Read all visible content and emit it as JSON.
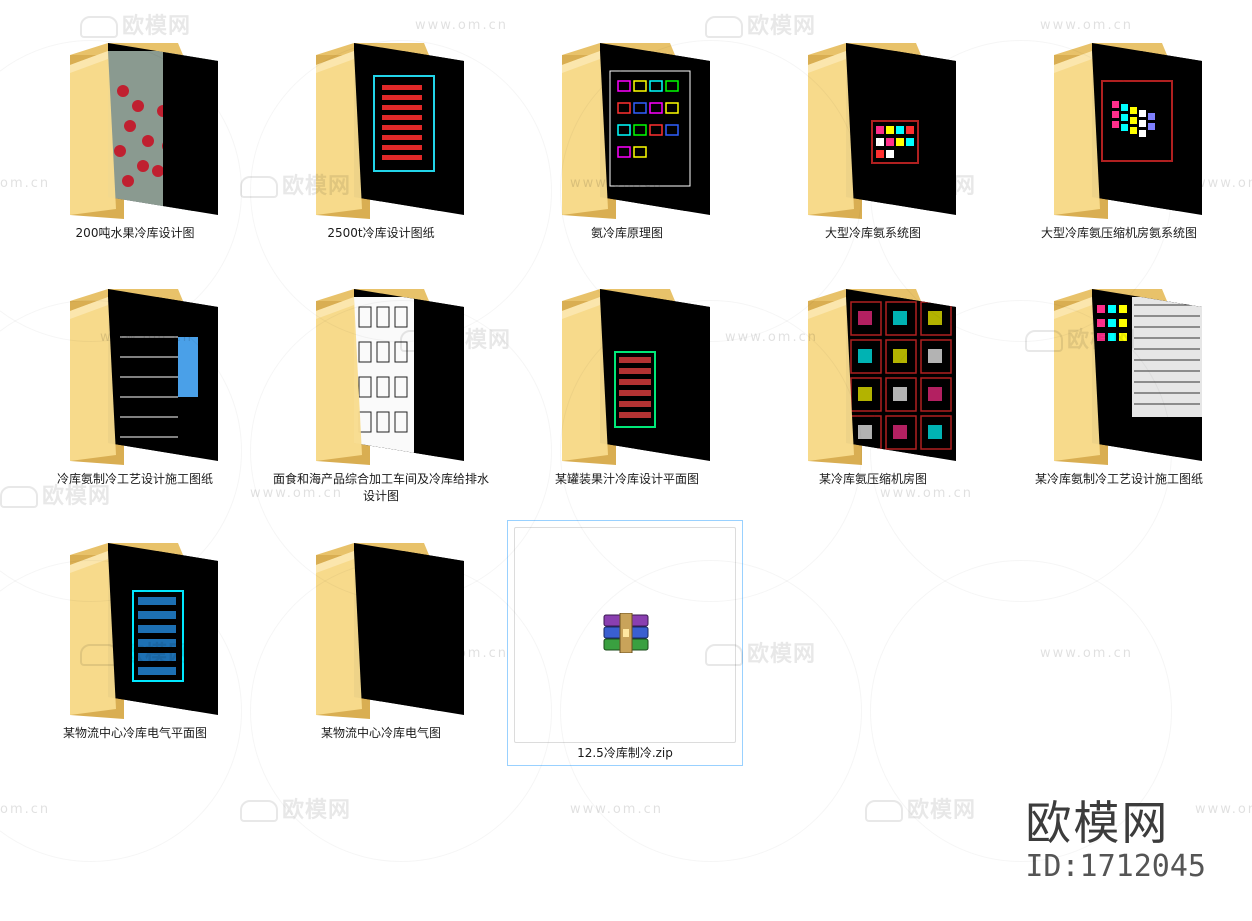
{
  "items": [
    {
      "name": "200吨水果冷库设计图",
      "thumb": "photo"
    },
    {
      "name": "2500t冷库设计图纸",
      "thumb": "cad-red"
    },
    {
      "name": "氨冷库原理图",
      "thumb": "cad-mag"
    },
    {
      "name": "大型冷库氨系统图",
      "thumb": "cad-small"
    },
    {
      "name": "大型冷库氨压缩机房氨系统图",
      "thumb": "cad-iso"
    },
    {
      "name": "冷库氨制冷工艺设计施工图纸",
      "thumb": "cad-table"
    },
    {
      "name": "面食和海产品综合加工车间及冷库给排水设计图",
      "thumb": "sketch"
    },
    {
      "name": "某罐装果汁冷库设计平面图",
      "thumb": "cad-green"
    },
    {
      "name": "某冷库氨压缩机房图",
      "thumb": "cad-grid"
    },
    {
      "name": "某冷库氨制冷工艺设计施工图纸",
      "thumb": "cad-sheet"
    },
    {
      "name": "某物流中心冷库电气平面图",
      "thumb": "cad-blue"
    },
    {
      "name": "某物流中心冷库电气图",
      "thumb": "black"
    },
    {
      "name": "12.5冷库制冷.zip",
      "thumb": "zip",
      "selected": true
    }
  ],
  "watermark": {
    "logo_text": "欧模网",
    "url_text": "www.om.cn",
    "short_url": "om.cn"
  },
  "brand": {
    "name": "欧模网",
    "id": "ID:1712045"
  },
  "colors": {
    "folder_back": "#e8c26a",
    "folder_front": "#f8dc8e",
    "selection_border": "#99d1ff"
  },
  "icons": {
    "folder": "folder-icon",
    "archive": "winrar-archive-icon"
  }
}
